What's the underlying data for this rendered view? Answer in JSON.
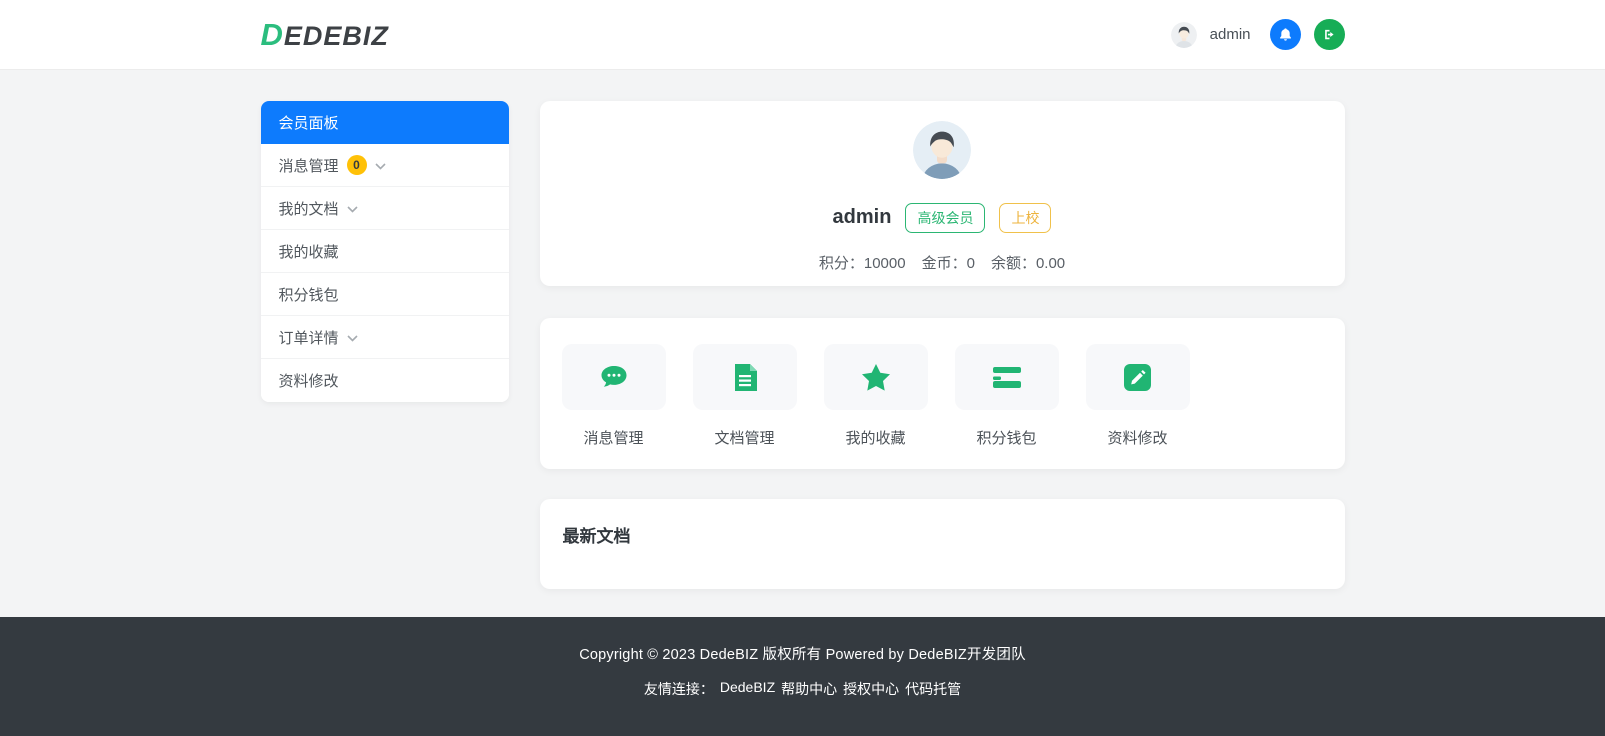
{
  "header": {
    "logo": {
      "first_letter": "D",
      "rest": "EDEBIZ"
    },
    "username": "admin"
  },
  "sidebar": {
    "items": [
      {
        "label": "会员面板",
        "active": true
      },
      {
        "label": "消息管理",
        "badge": "0",
        "chevron": true
      },
      {
        "label": "我的文档",
        "chevron": true
      },
      {
        "label": "我的收藏"
      },
      {
        "label": "积分钱包"
      },
      {
        "label": "订单详情",
        "chevron": true
      },
      {
        "label": "资料修改"
      }
    ]
  },
  "profile": {
    "username": "admin",
    "badges": [
      {
        "label": "高级会员",
        "style": "green"
      },
      {
        "label": "上校",
        "style": "yellow"
      }
    ],
    "stats": [
      {
        "label": "积分：",
        "value": "10000"
      },
      {
        "label": "金币：",
        "value": "0"
      },
      {
        "label": "余额：",
        "value": "0.00"
      }
    ]
  },
  "shortcuts": [
    {
      "label": "消息管理",
      "icon": "chat-bubble-icon"
    },
    {
      "label": "文档管理",
      "icon": "document-icon"
    },
    {
      "label": "我的收藏",
      "icon": "star-icon"
    },
    {
      "label": "积分钱包",
      "icon": "wallet-card-icon"
    },
    {
      "label": "资料修改",
      "icon": "edit-pencil-icon"
    }
  ],
  "latest_docs": {
    "title": "最新文档"
  },
  "footer": {
    "copyright": "Copyright © 2023 DedeBIZ 版权所有 Powered by DedeBIZ开发团队",
    "links_label": "友情连接：",
    "links": [
      "DedeBIZ",
      "帮助中心",
      "授权中心",
      "代码托管"
    ]
  },
  "colors": {
    "primary_blue": "#0d7bfd",
    "brand_green": "#2bbd7e",
    "icon_green": "#21b573",
    "logout_green": "#17ad56",
    "badge_yellow": "#ffc107",
    "footer_bg": "#343a40",
    "page_bg": "#f3f4f5"
  }
}
